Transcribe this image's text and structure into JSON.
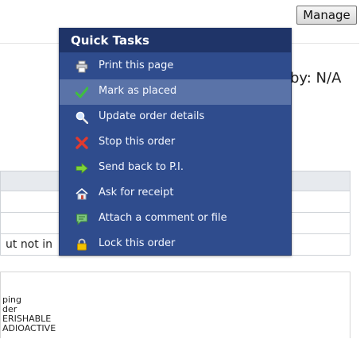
{
  "header": {
    "manage_label": "Manage",
    "by_text": "by: N/A"
  },
  "table": {
    "rows": [
      "",
      "",
      "ut not in"
    ]
  },
  "details": {
    "lines": [
      "ping",
      "der",
      "ERISHABLE",
      "ADIOACTIVE"
    ]
  },
  "quick_tasks": {
    "title": "Quick Tasks",
    "items": [
      {
        "label": "Print this page",
        "icon": "printer-icon"
      },
      {
        "label": "Mark as placed",
        "icon": "checkmark-icon",
        "highlighted": true
      },
      {
        "label": "Update order details",
        "icon": "magnifier-icon"
      },
      {
        "label": "Stop this order",
        "icon": "red-x-icon"
      },
      {
        "label": "Send back to P.I.",
        "icon": "green-arrow-icon"
      },
      {
        "label": "Ask for receipt",
        "icon": "house-icon"
      },
      {
        "label": "Attach a comment or file",
        "icon": "comment-icon"
      },
      {
        "label": "Lock this order",
        "icon": "padlock-icon"
      }
    ]
  }
}
